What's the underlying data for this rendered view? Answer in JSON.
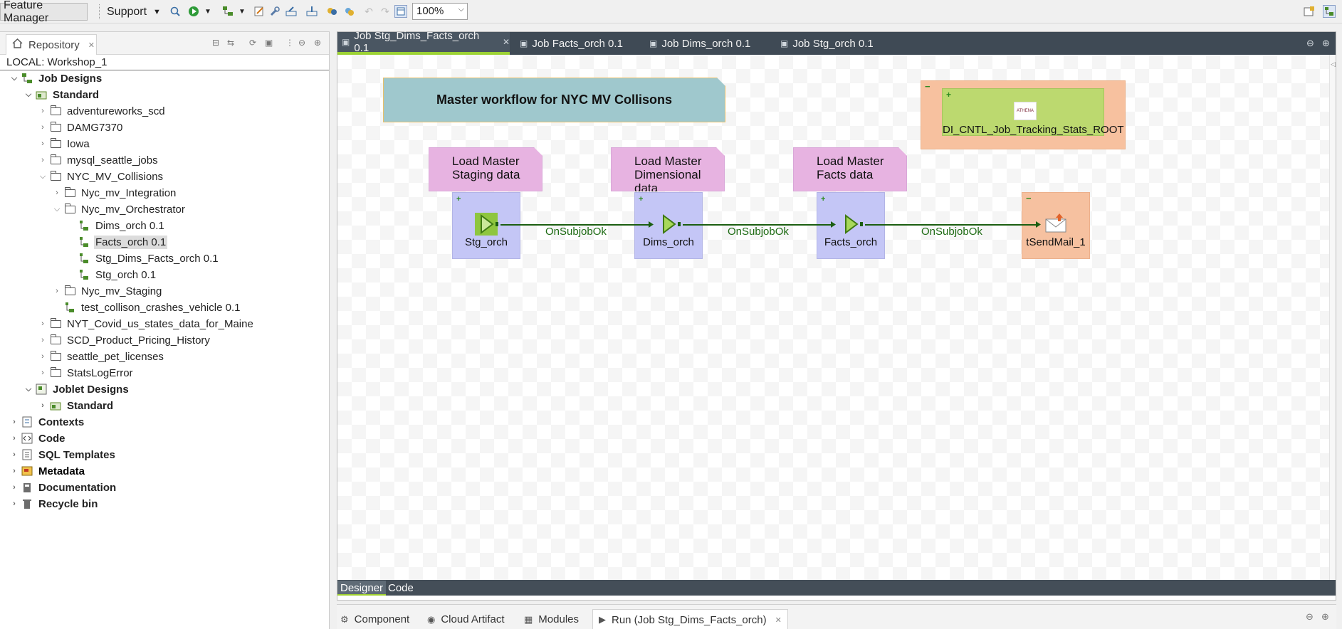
{
  "toolbar": {
    "feature_manager": "Feature Manager",
    "support": "Support",
    "zoom": "100%"
  },
  "repository": {
    "tab_label": "Repository",
    "local_label": "LOCAL: Workshop_1",
    "tree": [
      {
        "label": "Job Designs",
        "bold": true
      },
      {
        "label": "Standard",
        "bold": true
      },
      {
        "label": "adventureworks_scd"
      },
      {
        "label": "DAMG7370"
      },
      {
        "label": "Iowa"
      },
      {
        "label": "mysql_seattle_jobs"
      },
      {
        "label": "NYC_MV_Collisions"
      },
      {
        "label": "Nyc_mv_Integration"
      },
      {
        "label": "Nyc_mv_Orchestrator"
      },
      {
        "label": "Dims_orch 0.1"
      },
      {
        "label": "Facts_orch 0.1",
        "selected": true
      },
      {
        "label": "Stg_Dims_Facts_orch 0.1"
      },
      {
        "label": "Stg_orch 0.1"
      },
      {
        "label": "Nyc_mv_Staging"
      },
      {
        "label": "test_collison_crashes_vehicle 0.1"
      },
      {
        "label": "NYT_Covid_us_states_data_for_Maine"
      },
      {
        "label": "SCD_Product_Pricing_History"
      },
      {
        "label": "seattle_pet_licenses"
      },
      {
        "label": "StatsLogError"
      },
      {
        "label": "Joblet Designs",
        "bold": true
      },
      {
        "label": "Standard",
        "bold": true
      },
      {
        "label": "Contexts",
        "bold": true
      },
      {
        "label": "Code",
        "bold": true
      },
      {
        "label": "SQL Templates",
        "bold": true
      },
      {
        "label": "Metadata",
        "bold": true
      },
      {
        "label": "Documentation",
        "bold": true
      },
      {
        "label": "Recycle bin",
        "bold": true
      }
    ]
  },
  "editor": {
    "tabs": [
      {
        "label": "Job Stg_Dims_Facts_orch 0.1",
        "active": true
      },
      {
        "label": "Job Facts_orch 0.1"
      },
      {
        "label": "Job Dims_orch 0.1"
      },
      {
        "label": "Job Stg_orch 0.1"
      }
    ],
    "notes": {
      "title": "Master workflow for NYC MV Collisons",
      "staging": [
        "Load Master",
        "Staging data"
      ],
      "dimensional": [
        "Load Master",
        "Dimensional data"
      ],
      "facts": [
        "Load Master",
        "Facts data"
      ]
    },
    "components": {
      "stg": "Stg_orch",
      "dims": "Dims_orch",
      "facts": "Facts_orch",
      "mail": "tSendMail_1",
      "tracking": "DI_CNTL_Job_Tracking_Stats_ROOT",
      "tracking_logo": "ATHENA"
    },
    "links": [
      "OnSubjobOk",
      "OnSubjobOk",
      "OnSubjobOk"
    ],
    "bottom_tabs": {
      "designer": "Designer",
      "code": "Code"
    }
  },
  "lower_views": {
    "component": "Component",
    "cloud": "Cloud Artifact",
    "modules": "Modules",
    "run": "Run (Job Stg_Dims_Facts_orch)"
  },
  "colors": {
    "editor_tabbar": "#3f4a55",
    "accent_green": "#9cd234",
    "subjob_blue": "#c4c6f6",
    "note_pink": "#e7b3e1",
    "note_teal": "#9fc8cd",
    "link_green": "#1e6b14"
  }
}
